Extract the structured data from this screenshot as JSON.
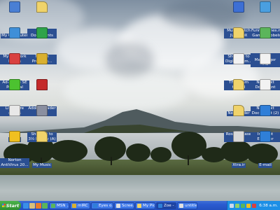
{
  "desktop": {
    "left_icons": [
      {
        "label": "My Computer",
        "icon": "my-computer-icon",
        "color": "#4a7fd4"
      },
      {
        "label": "My Documents",
        "icon": "folder-icon",
        "color": "#f0d36a"
      },
      {
        "label": "My Network Places",
        "icon": "network-places-icon",
        "color": "#3f8fd8"
      },
      {
        "label": "Norton Protecte...",
        "icon": "norton-protected-recycle-bin-icon",
        "color": "#2fa34a"
      },
      {
        "label": "Ad-Aware SE Personal",
        "icon": "ad-aware-icon",
        "color": "#d94040"
      },
      {
        "label": "mIRC",
        "icon": "mirc-icon",
        "color": "#d9b030"
      },
      {
        "label": "LimeWire 4.10.5",
        "icon": "limewire-icon",
        "color": "#4cc230"
      },
      {
        "label": "Adobe Reader 7.0",
        "icon": "adobe-reader-icon",
        "color": "#c42a2a"
      },
      {
        "label": "Insult",
        "icon": "file-icon",
        "color": "#e8e8e8"
      },
      {
        "label": "Shortcut to 3½ Floppy (A)",
        "icon": "floppy-drive-icon",
        "color": "#8a8fa0"
      },
      {
        "label": "Norton AntiVirus 20...",
        "icon": "norton-antivirus-icon",
        "color": "#f0c020"
      },
      {
        "label": "My Music",
        "icon": "music-folder-icon",
        "color": "#f0d36a"
      }
    ],
    "right_icons": [
      {
        "label": "Musicmatch JUKEBOX",
        "icon": "musicmatch-icon",
        "color": "#3d6fd4"
      },
      {
        "label": "FunnyGames.nl Game Bubbels",
        "icon": "game-bubbles-icon",
        "color": "#4a9fe0"
      },
      {
        "label": "Shortcut to Digital Cam...",
        "icon": "folder-icon",
        "color": "#f0d36a"
      },
      {
        "label": "MSN Messenger 7.5",
        "icon": "msn-messenger-icon",
        "color": "#5bb55b"
      },
      {
        "label": "The Spam thread",
        "icon": "text-document-icon",
        "color": "#f2f2f2"
      },
      {
        "label": "New Text Document",
        "icon": "text-document-icon",
        "color": "#f2f2f2"
      },
      {
        "label": "New Folder",
        "icon": "folder-icon",
        "color": "#f0d36a"
      },
      {
        "label": "New Text Document (2)",
        "icon": "text-document-icon",
        "color": "#f2f2f2"
      },
      {
        "label": "Rose disease crap",
        "icon": "folder-icon",
        "color": "#f0d36a"
      },
      {
        "label": "Internet Explorer",
        "icon": "internet-explorer-icon",
        "color": "#2f7fd8"
      },
      {
        "label": "Xtra.ir",
        "icon": "xtra-icon",
        "color": "#d8d8d8"
      },
      {
        "label": "E-mail",
        "icon": "email-icon",
        "color": "#2f7fd8"
      }
    ]
  },
  "taskbar": {
    "start_label": "Start",
    "tasks": [
      {
        "label": "MSN ...",
        "icon": "msn-messenger-icon",
        "color": "#5bb55b"
      },
      {
        "label": "mIRC ...",
        "icon": "mirc-icon",
        "color": "#d9b030"
      },
      {
        "label": "Eyes o...",
        "icon": "internet-explorer-icon",
        "color": "#2f7fd8"
      },
      {
        "label": "Scree...",
        "icon": "paint-icon",
        "color": "#e0e0e0"
      },
      {
        "label": "My Pic...",
        "icon": "folder-icon",
        "color": "#f0d36a"
      },
      {
        "label": "Zoe - ...",
        "icon": "internet-explorer-icon",
        "color": "#2f7fd8"
      },
      {
        "label": "untitle...",
        "icon": "paint-icon",
        "color": "#e0e0e0"
      }
    ],
    "clock": "6:38 a.m."
  }
}
